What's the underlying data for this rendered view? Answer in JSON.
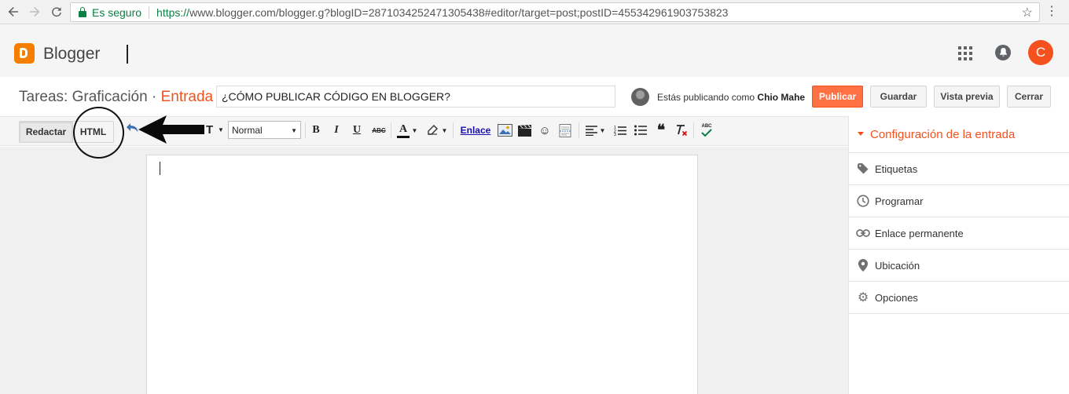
{
  "browser": {
    "secure_label": "Es seguro",
    "url_scheme": "https://",
    "url_rest": "www.blogger.com/blogger.g?blogID=2871034252471305438#editor/target=post;postID=455342961903753823"
  },
  "header": {
    "brand": "Blogger",
    "avatar_letter": "C"
  },
  "titlebar": {
    "crumb_prefix": "Tareas: Graficación · ",
    "crumb_accent": "Entrada",
    "post_title": "¿CÓMO PUBLICAR CÓDIGO EN BLOGGER?",
    "publishing_as": "Estás publicando como",
    "user_name": "Chio Mahe",
    "publish_label": "Publicar",
    "save_label": "Guardar",
    "preview_label": "Vista previa",
    "close_label": "Cerrar"
  },
  "toolbar": {
    "compose_tab": "Redactar",
    "html_tab": "HTML",
    "font_size": "Normal",
    "bold": "B",
    "italic": "I",
    "underline": "U",
    "strike": "ABC",
    "text_color": "A",
    "link_label": "Enlace",
    "spell": "ABC"
  },
  "sidebar": {
    "header": "Configuración de la entrada",
    "items": [
      {
        "label": "Etiquetas",
        "icon": "tag-icon"
      },
      {
        "label": "Programar",
        "icon": "clock-icon"
      },
      {
        "label": "Enlace permanente",
        "icon": "link-icon"
      },
      {
        "label": "Ubicación",
        "icon": "location-pin-icon"
      },
      {
        "label": "Opciones",
        "icon": "gear-icon"
      }
    ]
  },
  "colors": {
    "accent": "#f4511e",
    "publish_bg": "#ff7043",
    "secure_green": "#0b8043",
    "link_blue": "#1a0dab"
  }
}
